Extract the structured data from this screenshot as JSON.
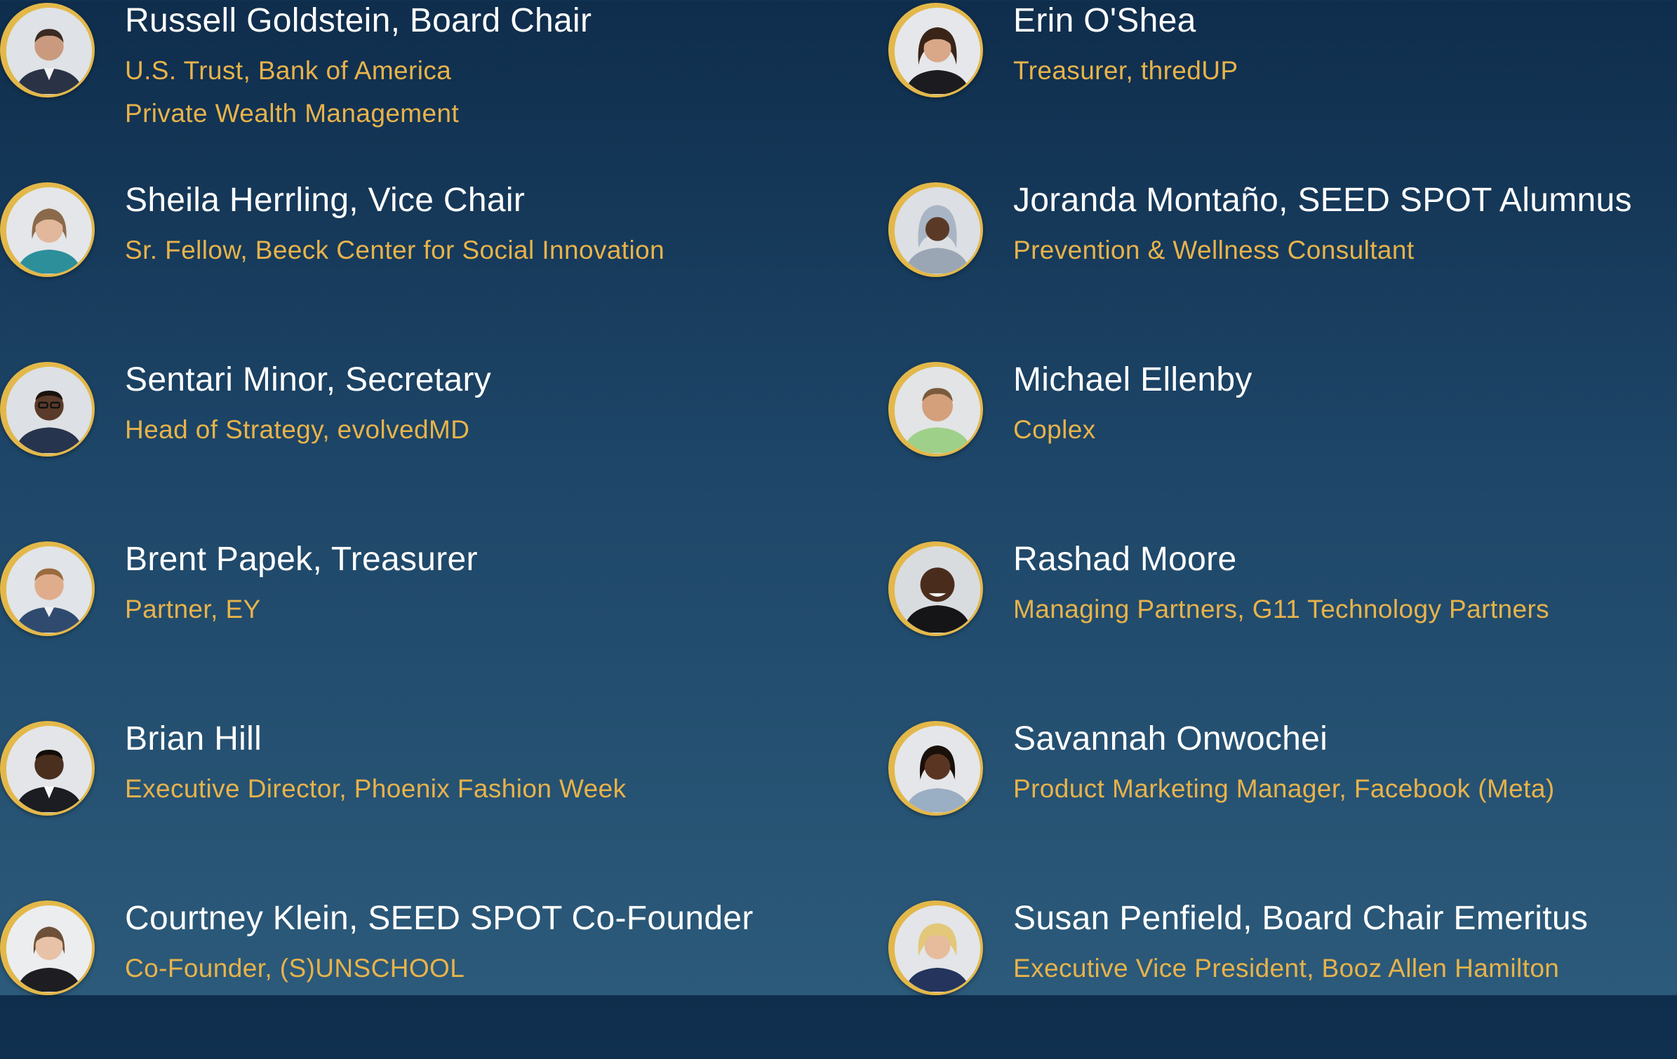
{
  "colors": {
    "name": "#ffffff",
    "role": "#e8b34a",
    "ring": "#e3b84a",
    "background_top": "#0f2d4c",
    "background_bottom": "#2c5a7a"
  },
  "left": [
    {
      "name": "Russell Goldstein, Board Chair",
      "roles": [
        "U.S. Trust, Bank of America",
        "Private Wealth Management"
      ]
    },
    {
      "name": "Sheila Herrling, Vice Chair",
      "roles": [
        "Sr. Fellow, Beeck Center for Social Innovation"
      ]
    },
    {
      "name": "Sentari Minor, Secretary",
      "roles": [
        "Head of Strategy, evolvedMD"
      ]
    },
    {
      "name": "Brent Papek, Treasurer",
      "roles": [
        "Partner, EY"
      ]
    },
    {
      "name": "Brian Hill",
      "roles": [
        "Executive Director, Phoenix Fashion Week"
      ]
    },
    {
      "name": "Courtney Klein, SEED SPOT Co-Founder",
      "roles": [
        "Co-Founder, (S)UNSCHOOL"
      ]
    }
  ],
  "right": [
    {
      "name": "Erin O'Shea",
      "roles": [
        "Treasurer, thredUP"
      ]
    },
    {
      "name": "Joranda Montaño, SEED SPOT Alumnus",
      "roles": [
        "Prevention & Wellness Consultant"
      ]
    },
    {
      "name": "Michael Ellenby",
      "roles": [
        "Coplex"
      ]
    },
    {
      "name": "Rashad Moore",
      "roles": [
        "Managing Partners, G11 Technology Partners"
      ]
    },
    {
      "name": "Savannah Onwochei",
      "roles": [
        "Product Marketing Manager, Facebook (Meta)"
      ]
    },
    {
      "name": "Susan Penfield, Board Chair Emeritus",
      "roles": [
        "Executive Vice President, Booz Allen Hamilton"
      ]
    }
  ]
}
